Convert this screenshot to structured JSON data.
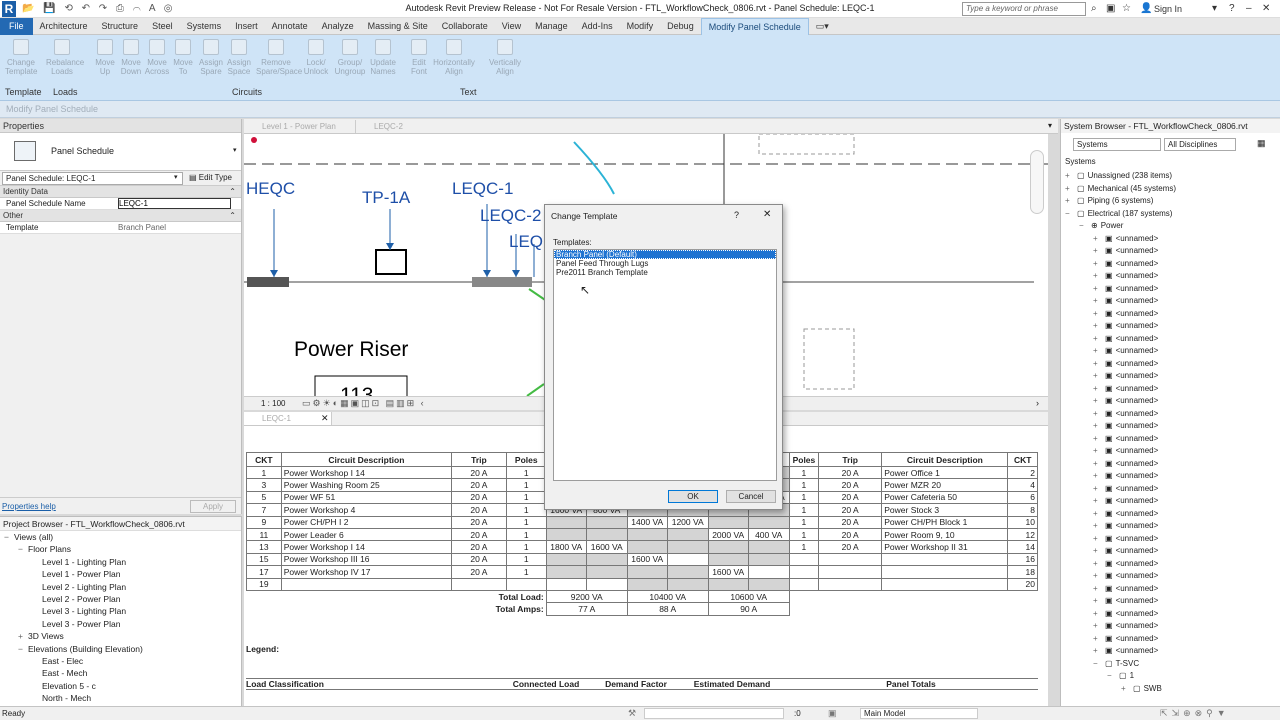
{
  "app": {
    "logo_letter": "R",
    "window_title": "Autodesk Revit Preview Release - Not For Resale Version - FTL_WorkflowCheck_0806.rvt - Panel Schedule: LEQC-1",
    "search_placeholder": "Type a keyword or phrase",
    "sign_in": "Sign In"
  },
  "ribbon_tabs": [
    "File",
    "Architecture",
    "Structure",
    "Steel",
    "Systems",
    "Insert",
    "Annotate",
    "Analyze",
    "Massing & Site",
    "Collaborate",
    "View",
    "Manage",
    "Add-Ins",
    "Modify",
    "Debug",
    "Modify Panel Schedule"
  ],
  "ribbon": {
    "buttons": [
      {
        "l1": "Change",
        "l2": "Template"
      },
      {
        "l1": "Rebalance",
        "l2": "Loads"
      },
      {
        "l1": "Move",
        "l2": "Up"
      },
      {
        "l1": "Move",
        "l2": "Down"
      },
      {
        "l1": "Move",
        "l2": "Across"
      },
      {
        "l1": "Move",
        "l2": "To"
      },
      {
        "l1": "Assign",
        "l2": "Spare"
      },
      {
        "l1": "Assign",
        "l2": "Space"
      },
      {
        "l1": "Remove",
        "l2": "Spare/Space"
      },
      {
        "l1": "Lock/",
        "l2": "Unlock"
      },
      {
        "l1": "Group/",
        "l2": "Ungroup"
      },
      {
        "l1": "Update",
        "l2": "Names"
      },
      {
        "l1": "Edit",
        "l2": "Font"
      },
      {
        "l1": "Horizontally",
        "l2": "Align"
      },
      {
        "l1": "Vertically",
        "l2": "Align"
      }
    ],
    "groups": [
      "Template",
      "Loads",
      "Circuits",
      "Text"
    ],
    "context_bar": "Modify Panel Schedule"
  },
  "properties": {
    "title": "Properties",
    "type_name": "Panel Schedule",
    "selector": "Panel Schedule: LEQC-1",
    "edit_type": "Edit Type",
    "sections": [
      {
        "name": "Identity Data",
        "rows": [
          {
            "k": "Panel Schedule Name",
            "v": "LEQC-1"
          }
        ]
      },
      {
        "name": "Other",
        "rows": [
          {
            "k": "Template",
            "v": "Branch Panel"
          }
        ]
      }
    ],
    "help": "Properties help",
    "apply": "Apply"
  },
  "project_browser": {
    "title": "Project Browser - FTL_WorkflowCheck_0806.rvt",
    "items": [
      {
        "t": "Views (all)",
        "d": 0,
        "e": "−"
      },
      {
        "t": "Floor Plans",
        "d": 1,
        "e": "−"
      },
      {
        "t": "Level 1 - Lighting Plan",
        "d": 2,
        "e": ""
      },
      {
        "t": "Level 1 - Power Plan",
        "d": 2,
        "e": ""
      },
      {
        "t": "Level 2 - Lighting Plan",
        "d": 2,
        "e": ""
      },
      {
        "t": "Level 2 - Power Plan",
        "d": 2,
        "e": ""
      },
      {
        "t": "Level 3 - Lighting Plan",
        "d": 2,
        "e": ""
      },
      {
        "t": "Level 3 - Power Plan",
        "d": 2,
        "e": ""
      },
      {
        "t": "3D Views",
        "d": 1,
        "e": "+"
      },
      {
        "t": "Elevations (Building Elevation)",
        "d": 1,
        "e": "−"
      },
      {
        "t": "East - Elec",
        "d": 2,
        "e": ""
      },
      {
        "t": "East - Mech",
        "d": 2,
        "e": ""
      },
      {
        "t": "Elevation 5 - c",
        "d": 2,
        "e": ""
      },
      {
        "t": "North - Mech",
        "d": 2,
        "e": ""
      }
    ]
  },
  "view_tabs": {
    "top": [
      "Level 1 - Power Plan",
      "LEQC-2"
    ],
    "bottom": "LEQC-1"
  },
  "drawing": {
    "labels": [
      "HEQC",
      "TP-1A",
      "LEQC-1",
      "LEQC-2",
      "LEQ"
    ],
    "riser_title": "Power Riser",
    "room_number": "113",
    "scale": "1 : 100"
  },
  "schedule": {
    "headers_left": [
      "CKT",
      "Circuit Description",
      "Trip",
      "Poles"
    ],
    "headers_right": [
      "Poles",
      "Trip",
      "Circuit Description",
      "CKT"
    ],
    "rows": [
      {
        "ckt": "1",
        "desc": "Power Workshop I 14",
        "trip": "20 A",
        "poles": "1",
        "a": "20",
        "b": "",
        "c": "",
        "rp": "1",
        "rt": "20 A",
        "rd": "Power Office 1",
        "rc": "2"
      },
      {
        "ckt": "3",
        "desc": "Power Washing Room 25",
        "trip": "20 A",
        "poles": "1",
        "a": "",
        "b": "",
        "c": "",
        "rp": "1",
        "rt": "20 A",
        "rd": "Power MZR 20",
        "rc": "4"
      },
      {
        "ckt": "5",
        "desc": "Power WF 51",
        "trip": "20 A",
        "poles": "1",
        "a": "",
        "b": "",
        "c": "1800 VA",
        "c2": "1800 VA",
        "rp": "1",
        "rt": "20 A",
        "rd": "Power Cafeteria 50",
        "rc": "6"
      },
      {
        "ckt": "7",
        "desc": "Power Workshop 4",
        "trip": "20 A",
        "poles": "1",
        "a": "1600 VA",
        "a2": "800 VA",
        "b": "",
        "c": "",
        "rp": "1",
        "rt": "20 A",
        "rd": "Power Stock 3",
        "rc": "8"
      },
      {
        "ckt": "9",
        "desc": "Power CH/PH I 2",
        "trip": "20 A",
        "poles": "1",
        "a": "",
        "b": "1400 VA",
        "b2": "1200 VA",
        "c": "",
        "rp": "1",
        "rt": "20 A",
        "rd": "Power CH/PH Block 1",
        "rc": "10"
      },
      {
        "ckt": "11",
        "desc": "Power Leader 6",
        "trip": "20 A",
        "poles": "1",
        "a": "",
        "b": "",
        "c": "2000 VA",
        "c2": "400 VA",
        "rp": "1",
        "rt": "20 A",
        "rd": "Power Room 9, 10",
        "rc": "12"
      },
      {
        "ckt": "13",
        "desc": "Power Workshop I 14",
        "trip": "20 A",
        "poles": "1",
        "a": "1800 VA",
        "a2": "1600 VA",
        "b": "",
        "c": "",
        "rp": "1",
        "rt": "20 A",
        "rd": "Power Workshop II 31",
        "rc": "14"
      },
      {
        "ckt": "15",
        "desc": "Power Workshop III 16",
        "trip": "20 A",
        "poles": "1",
        "a": "",
        "b": "1600 VA",
        "c": "",
        "rp": "",
        "rt": "",
        "rd": "",
        "rc": "16"
      },
      {
        "ckt": "17",
        "desc": "Power Workshop IV 17",
        "trip": "20 A",
        "poles": "1",
        "a": "",
        "b": "",
        "c": "1600 VA",
        "rp": "",
        "rt": "",
        "rd": "",
        "rc": "18"
      },
      {
        "ckt": "19",
        "desc": "",
        "trip": "",
        "poles": "",
        "a": "",
        "b": "",
        "c": "",
        "rp": "",
        "rt": "",
        "rd": "",
        "rc": "20"
      }
    ],
    "total_load_label": "Total Load:",
    "total_amps_label": "Total Amps:",
    "total_load": [
      "9200 VA",
      "10400 VA",
      "10600 VA"
    ],
    "total_amps": [
      "77 A",
      "88 A",
      "90 A"
    ],
    "legend_label": "Legend:",
    "summary_headers": [
      "Load Classification",
      "Connected Load",
      "Demand Factor",
      "Estimated Demand",
      "Panel Totals"
    ]
  },
  "system_browser": {
    "title": "System Browser - FTL_WorkflowCheck_0806.rvt",
    "view_select": "Systems",
    "discipline_select": "All Disciplines",
    "column": "Systems",
    "top_items": [
      {
        "t": "Unassigned (238 items)",
        "e": "+"
      },
      {
        "t": "Mechanical (45 systems)",
        "e": "+"
      },
      {
        "t": "Piping (6 systems)",
        "e": "+"
      },
      {
        "t": "Electrical (187 systems)",
        "e": "−"
      }
    ],
    "power_label": "Power",
    "unnamed_label": "<unnamed>",
    "unnamed_count": 34,
    "bottom_items": [
      "T-SVC",
      "1",
      "SWB"
    ]
  },
  "dialog": {
    "title": "Change Template",
    "help": "?",
    "close": "✕",
    "list_label": "Templates:",
    "templates": [
      "Branch Panel (Default)",
      "Panel Feed Through Lugs",
      "Pre2011 Branch Template"
    ],
    "selected_index": 0,
    "ok": "OK",
    "cancel": "Cancel"
  },
  "status": {
    "ready": "Ready",
    "zero": ":0",
    "model": "Main Model"
  }
}
